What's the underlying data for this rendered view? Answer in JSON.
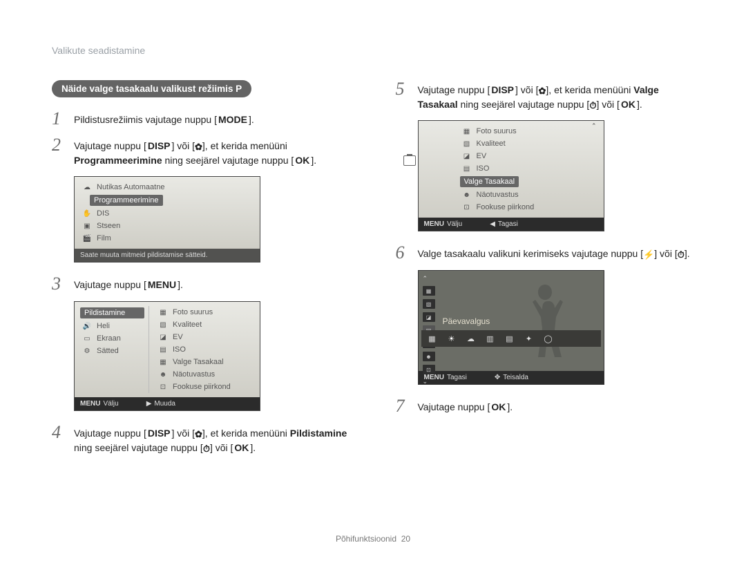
{
  "header": "Valikute seadistamine",
  "pill": "Näide valge tasakaalu valikust režiimis P",
  "steps": {
    "s1_a": "Pildistusrežiimis vajutage nuppu [",
    "s1_btn": "MODE",
    "s1_b": "].",
    "s2_a": "Vajutage nuppu [",
    "s2_btn1": "DISP",
    "s2_b": "] või [",
    "s2_icon": "✿",
    "s2_c": "], et kerida menüüni ",
    "s2_bold": "Programmeerimine",
    "s2_d": " ning seejärel vajutage nuppu [",
    "s2_ok": "OK",
    "s2_e": "].",
    "s3_a": "Vajutage nuppu [",
    "s3_btn": "MENU",
    "s3_b": "].",
    "s4_a": "Vajutage nuppu [",
    "s4_btn1": "DISP",
    "s4_b": "] või [",
    "s4_icon": "✿",
    "s4_c": "], et kerida menüüni ",
    "s4_bold": "Pildistamine",
    "s4_d": " ning seejärel vajutage nuppu [",
    "s4_timer": "⏱",
    "s4_e": "] või [",
    "s4_ok": "OK",
    "s4_f": "].",
    "s5_a": "Vajutage nuppu [",
    "s5_btn1": "DISP",
    "s5_b": "] või [",
    "s5_icon": "✿",
    "s5_c": "], et kerida menüüni ",
    "s5_bold": "Valge Tasakaal",
    "s5_d": " ning seejärel vajutage nuppu [",
    "s5_timer": "⏱",
    "s5_e": "] või [",
    "s5_ok": "OK",
    "s5_f": "].",
    "s6_a": "Valge tasakaalu valikuni kerimiseks vajutage nuppu [",
    "s6_flash": "⚡",
    "s6_b": "] või [",
    "s6_timer": "⏱",
    "s6_c": "].",
    "s7_a": "Vajutage nuppu [",
    "s7_ok": "OK",
    "s7_b": "]."
  },
  "screen1": {
    "items": [
      "Nutikas Automaatne",
      "Programmeerimine",
      "DIS",
      "Stseen",
      "Film"
    ],
    "hint": "Saate muuta mitmeid pildistamise sätteid."
  },
  "screen2": {
    "left": [
      "Pildistamine",
      "Heli",
      "Ekraan",
      "Sätted"
    ],
    "right": [
      "Foto suurus",
      "Kvaliteet",
      "EV",
      "ISO",
      "Valge Tasakaal",
      "Näotuvastus",
      "Fookuse piirkond"
    ],
    "foot_left": "Välju",
    "foot_right": "Muuda",
    "menu_glyph": "MENU"
  },
  "screen3": {
    "right": [
      "Foto suurus",
      "Kvaliteet",
      "EV",
      "ISO",
      "Valge Tasakaal",
      "Näotuvastus",
      "Fookuse piirkond"
    ],
    "foot_left": "Välju",
    "foot_right": "Tagasi",
    "menu_glyph": "MENU"
  },
  "live": {
    "label": "Päevavalgus",
    "foot_left": "Tagasi",
    "foot_right": "Teisalda",
    "menu_glyph": "MENU"
  },
  "footer": {
    "label": "Põhifunktsioonid",
    "page": "20"
  }
}
